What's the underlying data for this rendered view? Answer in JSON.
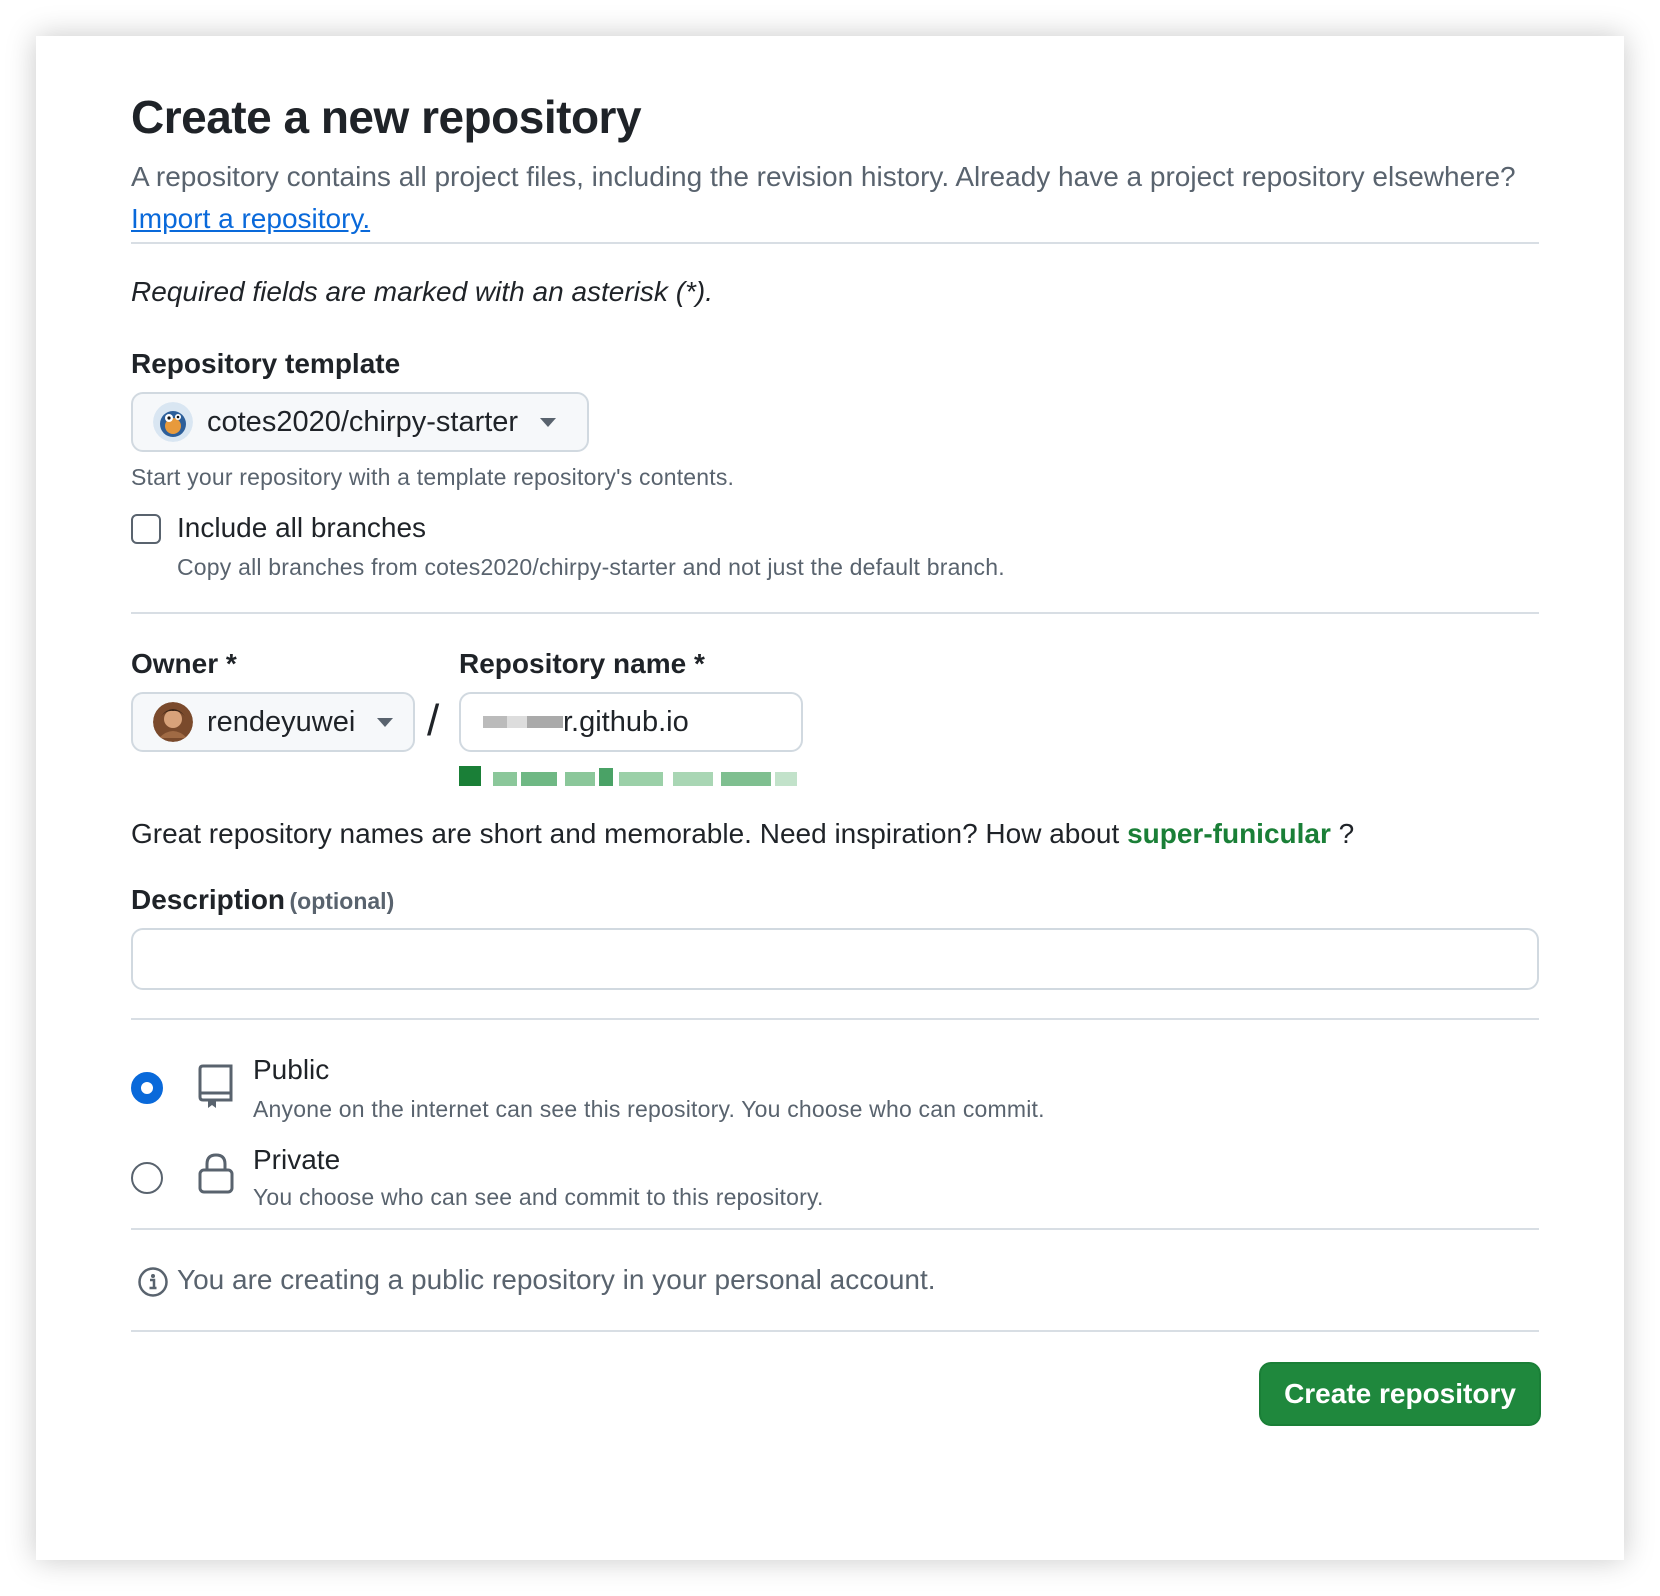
{
  "header": {
    "title": "Create a new repository",
    "subtitle": "A repository contains all project files, including the revision history. Already have a project repository elsewhere?",
    "import_link": "Import a repository."
  },
  "required_note": "Required fields are marked with an asterisk (*).",
  "template": {
    "label": "Repository template",
    "selected": "cotes2020/chirpy-starter",
    "help": "Start your repository with a template repository's contents."
  },
  "include_branches": {
    "label": "Include all branches",
    "help": "Copy all branches from cotes2020/chirpy-starter and not just the default branch.",
    "checked": false
  },
  "owner": {
    "label": "Owner *",
    "selected": "rendeyuwei"
  },
  "separator": "/",
  "repo_name": {
    "label": "Repository name *",
    "value_suffix": "r.github.io"
  },
  "suggestion": {
    "text": "Great repository names are short and memorable. Need inspiration? How about",
    "name": "super-funicular",
    "suffix": "?"
  },
  "description": {
    "label": "Description",
    "optional": "(optional)",
    "value": ""
  },
  "visibility": {
    "selected": "public",
    "public": {
      "title": "Public",
      "desc": "Anyone on the internet can see this repository. You choose who can commit."
    },
    "private": {
      "title": "Private",
      "desc": "You choose who can see and commit to this repository."
    }
  },
  "info_note": "You are creating a public repository in your personal account.",
  "create_button": "Create repository",
  "colors": {
    "accent_blue": "#0969da",
    "primary_green": "#1f883d",
    "suggestion_green": "#1a7f37",
    "muted_text": "#59636e"
  }
}
